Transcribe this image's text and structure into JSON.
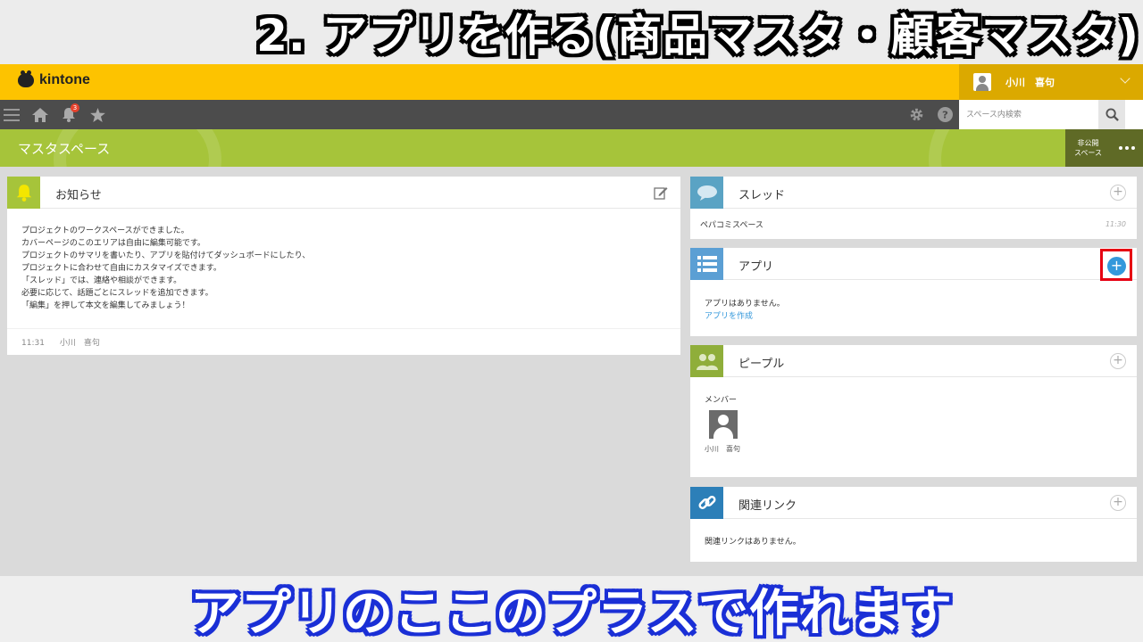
{
  "captions": {
    "top": "2. アプリを作る(商品マスタ・顧客マスタ)",
    "bottom": "アプリのここのプラスで作れます"
  },
  "header": {
    "logo_text": "kintone",
    "user_name": "小川　喜句"
  },
  "navbar": {
    "notification_count": "3",
    "search_placeholder": "スペース内検索"
  },
  "space": {
    "title": "マスタスペース",
    "private_label_line1": "非公開",
    "private_label_line2": "スペース"
  },
  "notice": {
    "title": "お知らせ",
    "lines": [
      "プロジェクトのワークスペースができました。",
      "カバーページのこのエリアは自由に編集可能です。",
      "プロジェクトのサマリを書いたり、アプリを貼付けてダッシュボードにしたり、",
      "プロジェクトに合わせて自由にカスタマイズできます。",
      "「スレッド」では、連絡や相談ができます。",
      "必要に応じて、話題ごとにスレッドを追加できます。",
      "「編集」を押して本文を編集してみましょう！"
    ],
    "time": "11:31",
    "author": "小川　喜句"
  },
  "thread": {
    "title": "スレッド",
    "item_name": "ペパコミスペース",
    "item_time": "11:30"
  },
  "apps": {
    "title": "アプリ",
    "empty_text": "アプリはありません。",
    "create_link": "アプリを作成"
  },
  "people": {
    "title": "ピープル",
    "members_label": "メンバー",
    "member_name": "小川　喜句"
  },
  "links": {
    "title": "関連リンク",
    "empty_text": "関連リンクはありません。"
  },
  "colors": {
    "header": "#fdc300",
    "navbar": "#4c4c4c",
    "space_banner": "#a6c43a",
    "accent": "#3498db",
    "highlight": "#e60012"
  }
}
